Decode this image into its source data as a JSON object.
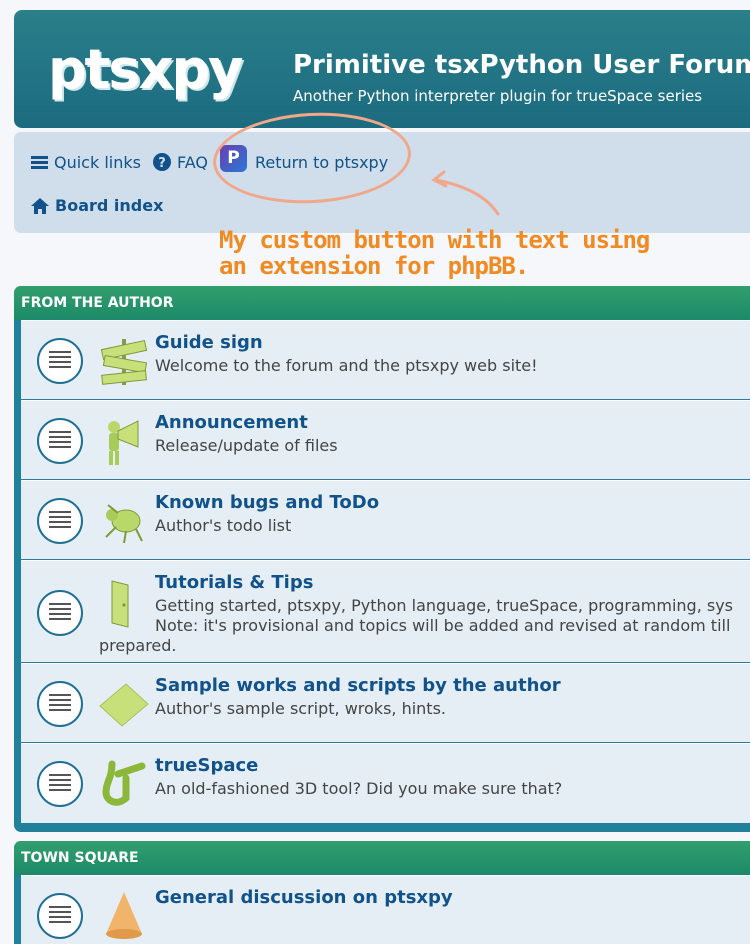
{
  "header": {
    "logo": "ptsxpy",
    "title": "Primitive tsxPython User Forum",
    "description": "Another Python interpreter plugin for trueSpace series"
  },
  "nav": {
    "quick_links": "Quick links",
    "faq": "FAQ",
    "return_link": "Return to ptsxpy",
    "board_index": "Board index"
  },
  "annotation": {
    "text_line1": "My custom button with text using",
    "text_line2": "an extension for phpBB.",
    "color": "#f08a22"
  },
  "categories": [
    {
      "name": "FROM THE AUTHOR",
      "forums": [
        {
          "title": "Guide sign",
          "desc": "Welcome to the forum and the ptsxpy web site!"
        },
        {
          "title": "Announcement",
          "desc": "Release/update of files"
        },
        {
          "title": "Known bugs and ToDo",
          "desc": "Author's todo list"
        },
        {
          "title": "Tutorials & Tips",
          "desc": "Getting started, ptsxpy, Python language, trueSpace, programming, sys",
          "desc2": "Note: it's provisional and topics will be added and revised at random till",
          "desc3": "prepared."
        },
        {
          "title": "Sample works and scripts by the author",
          "desc": "Author's sample script, wroks, hints."
        },
        {
          "title": "trueSpace",
          "desc": "An old-fashioned 3D tool? Did you make sure that?"
        }
      ]
    },
    {
      "name": "TOWN SQUARE",
      "forums": [
        {
          "title": "General discussion on ptsxpy",
          "desc": ""
        }
      ]
    }
  ],
  "icons": {
    "quick_links": "bars-icon",
    "faq": "question-circle-icon",
    "return": "ptsxpy-app-icon",
    "board_index": "home-icon",
    "forum_status": "forum-read-icon"
  }
}
